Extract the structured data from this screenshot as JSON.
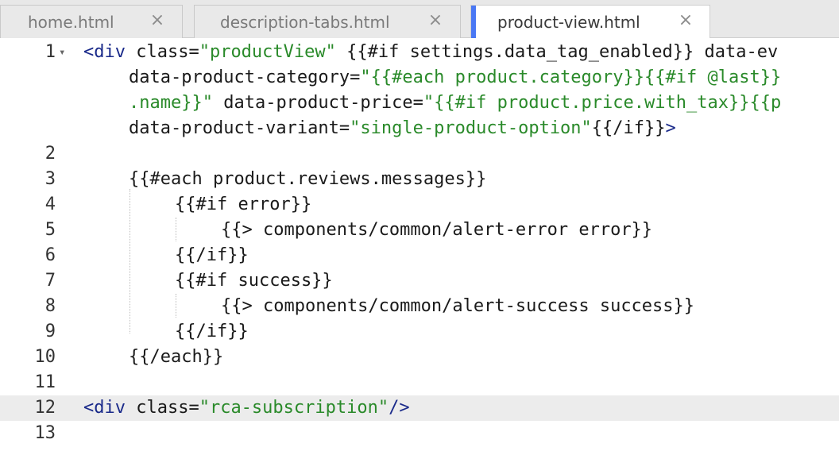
{
  "tabs": [
    {
      "label": "home.html",
      "active": false
    },
    {
      "label": "description-tabs.html",
      "active": false
    },
    {
      "label": "product-view.html",
      "active": true
    }
  ],
  "close_glyph": "×",
  "fold_glyph": "▾",
  "editor": {
    "current_line": "12",
    "lines": [
      {
        "num": "1",
        "tokens": [
          {
            "t": "tag",
            "v": "<div"
          },
          {
            "t": "attr",
            "v": " class="
          },
          {
            "t": "str",
            "v": "\"productView\""
          },
          {
            "t": "hb",
            "v": " {{#if settings.data_tag_enabled}} data-ev"
          }
        ]
      },
      {
        "num": "",
        "tokens": [
          {
            "t": "attr",
            "v": "data-product-category="
          },
          {
            "t": "str",
            "v": "\"{{#each product.category}}{{#if @last}}"
          }
        ]
      },
      {
        "num": "",
        "tokens": [
          {
            "t": "str",
            "v": ".name}}\""
          },
          {
            "t": "attr",
            "v": " data-product-price="
          },
          {
            "t": "str",
            "v": "\"{{#if product.price.with_tax}}{{p"
          }
        ]
      },
      {
        "num": "",
        "tokens": [
          {
            "t": "attr",
            "v": "data-product-variant="
          },
          {
            "t": "str",
            "v": "\"single-product-option\""
          },
          {
            "t": "hb",
            "v": "{{/if}}"
          },
          {
            "t": "tag",
            "v": ">"
          }
        ]
      },
      {
        "num": "2",
        "tokens": []
      },
      {
        "num": "3",
        "tokens": [
          {
            "t": "hb",
            "v": "{{#each product.reviews.messages}}"
          }
        ]
      },
      {
        "num": "4",
        "tokens": [
          {
            "t": "hb",
            "v": "{{#if error}}"
          }
        ]
      },
      {
        "num": "5",
        "tokens": [
          {
            "t": "hb",
            "v": "{{> components/common/alert-error error}}"
          }
        ]
      },
      {
        "num": "6",
        "tokens": [
          {
            "t": "hb",
            "v": "{{/if}}"
          }
        ]
      },
      {
        "num": "7",
        "tokens": [
          {
            "t": "hb",
            "v": "{{#if success}}"
          }
        ]
      },
      {
        "num": "8",
        "tokens": [
          {
            "t": "hb",
            "v": "{{> components/common/alert-success success}}"
          }
        ]
      },
      {
        "num": "9",
        "tokens": [
          {
            "t": "hb",
            "v": "{{/if}}"
          }
        ]
      },
      {
        "num": "10",
        "tokens": [
          {
            "t": "hb",
            "v": "{{/each}}"
          }
        ]
      },
      {
        "num": "11",
        "tokens": []
      },
      {
        "num": "12",
        "tokens": [
          {
            "t": "tag",
            "v": "<div"
          },
          {
            "t": "attr",
            "v": " class="
          },
          {
            "t": "str",
            "v": "\"rca-subscription\""
          },
          {
            "t": "tag",
            "v": "/>"
          }
        ]
      },
      {
        "num": "13",
        "tokens": []
      }
    ]
  }
}
